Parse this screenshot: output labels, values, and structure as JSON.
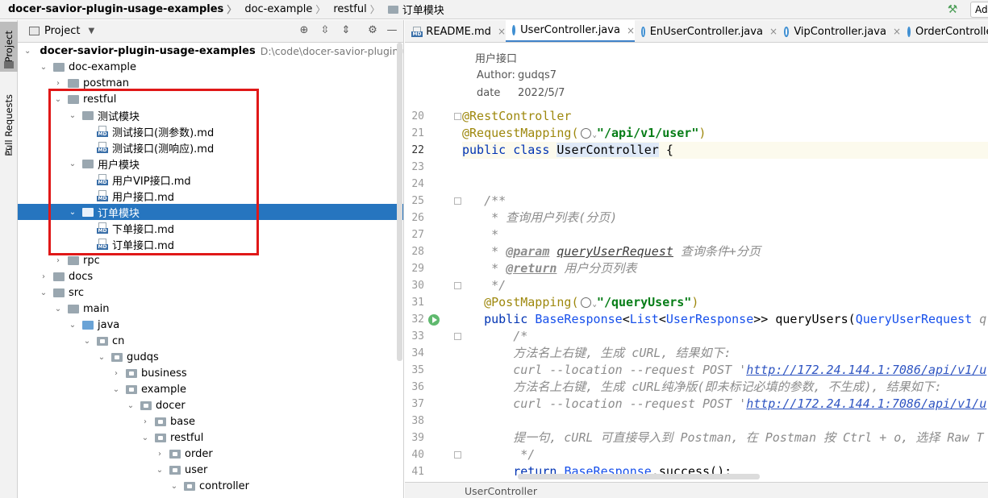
{
  "breadcrumb": [
    {
      "label": "docer-savior-plugin-usage-examples",
      "bold": true
    },
    {
      "label": "doc-example"
    },
    {
      "label": "restful"
    },
    {
      "label": "订单模块",
      "folder": true
    }
  ],
  "toolbar": {
    "add_label": "Ad"
  },
  "left_strip": {
    "project_label": "Project",
    "pull_requests_label": "Pull Requests"
  },
  "project_panel": {
    "title": "Project",
    "root_path": "D:\\code\\docer-savior-plugin-usage"
  },
  "tree": [
    {
      "label": "docer-savior-plugin-usage-examples",
      "depth": 0,
      "state": "open",
      "kind": "module",
      "bold": true
    },
    {
      "label": "doc-example",
      "depth": 1,
      "state": "open",
      "kind": "folder"
    },
    {
      "label": "postman",
      "depth": 2,
      "state": "closed",
      "kind": "folder"
    },
    {
      "label": "restful",
      "depth": 2,
      "state": "open",
      "kind": "folder"
    },
    {
      "label": "测试模块",
      "depth": 3,
      "state": "open",
      "kind": "folder"
    },
    {
      "label": "测试接口(测参数).md",
      "depth": 4,
      "state": "leaf",
      "kind": "md"
    },
    {
      "label": "测试接口(测响应).md",
      "depth": 4,
      "state": "leaf",
      "kind": "md"
    },
    {
      "label": "用户模块",
      "depth": 3,
      "state": "open",
      "kind": "folder"
    },
    {
      "label": "用户VIP接口.md",
      "depth": 4,
      "state": "leaf",
      "kind": "md"
    },
    {
      "label": "用户接口.md",
      "depth": 4,
      "state": "leaf",
      "kind": "md"
    },
    {
      "label": "订单模块",
      "depth": 3,
      "state": "open",
      "kind": "folder",
      "selected": true
    },
    {
      "label": "下单接口.md",
      "depth": 4,
      "state": "leaf",
      "kind": "md"
    },
    {
      "label": "订单接口.md",
      "depth": 4,
      "state": "leaf",
      "kind": "md"
    },
    {
      "label": "rpc",
      "depth": 2,
      "state": "closed",
      "kind": "folder"
    },
    {
      "label": "docs",
      "depth": 1,
      "state": "closed",
      "kind": "folder"
    },
    {
      "label": "src",
      "depth": 1,
      "state": "open",
      "kind": "folder"
    },
    {
      "label": "main",
      "depth": 2,
      "state": "open",
      "kind": "folder"
    },
    {
      "label": "java",
      "depth": 3,
      "state": "open",
      "kind": "src"
    },
    {
      "label": "cn",
      "depth": 4,
      "state": "open",
      "kind": "pkg"
    },
    {
      "label": "gudqs",
      "depth": 5,
      "state": "open",
      "kind": "pkg"
    },
    {
      "label": "business",
      "depth": 6,
      "state": "closed",
      "kind": "pkg"
    },
    {
      "label": "example",
      "depth": 6,
      "state": "open",
      "kind": "pkg"
    },
    {
      "label": "docer",
      "depth": 7,
      "state": "open",
      "kind": "pkg"
    },
    {
      "label": "base",
      "depth": 8,
      "state": "closed",
      "kind": "pkg"
    },
    {
      "label": "restful",
      "depth": 8,
      "state": "open",
      "kind": "pkg"
    },
    {
      "label": "order",
      "depth": 9,
      "state": "closed",
      "kind": "pkg"
    },
    {
      "label": "user",
      "depth": 9,
      "state": "open",
      "kind": "pkg"
    },
    {
      "label": "controller",
      "depth": 10,
      "state": "open",
      "kind": "pkg"
    }
  ],
  "tabs": [
    {
      "label": "README.md",
      "kind": "md",
      "active": false
    },
    {
      "label": "UserController.java",
      "kind": "java",
      "active": true
    },
    {
      "label": "EnUserController.java",
      "kind": "java",
      "active": false
    },
    {
      "label": "VipController.java",
      "kind": "java",
      "active": false
    },
    {
      "label": "OrderControlle",
      "kind": "java",
      "active": false
    }
  ],
  "doc_block": {
    "title": "用户接口",
    "author_label": "Author:",
    "author_value": "gudqs7",
    "date_label": "date",
    "date_value": "2022/5/7"
  },
  "code_lines": [
    {
      "n": "20",
      "text": "@RestController"
    },
    {
      "n": "21",
      "text": "@RequestMapping(\"/api/v1/user\")"
    },
    {
      "n": "22",
      "text": "public class UserController {"
    },
    {
      "n": "23",
      "text": ""
    },
    {
      "n": "24",
      "text": ""
    },
    {
      "n": "25",
      "text": "    /**"
    },
    {
      "n": "26",
      "text": "     * 查询用户列表(分页)"
    },
    {
      "n": "27",
      "text": "     *"
    },
    {
      "n": "28",
      "text": "     * @param queryUserRequest 查询条件+分页"
    },
    {
      "n": "29",
      "text": "     * @return 用户分页列表"
    },
    {
      "n": "30",
      "text": "     */"
    },
    {
      "n": "31",
      "text": "    @PostMapping(\"/queryUsers\")"
    },
    {
      "n": "32",
      "text": "    public BaseResponse<List<UserResponse>> queryUsers(QueryUserRequest q"
    },
    {
      "n": "33",
      "text": "        /*"
    },
    {
      "n": "34",
      "text": "        方法名上右键, 生成 cURL, 结果如下:"
    },
    {
      "n": "35",
      "text": "        curl --location --request POST 'http://172.24.144.1:7086/api/v1/u"
    },
    {
      "n": "36",
      "text": "        方法名上右键, 生成 cURL纯净版(即未标记必填的参数, 不生成), 结果如下:"
    },
    {
      "n": "37",
      "text": "        curl --location --request POST 'http://172.24.144.1:7086/api/v1/u"
    },
    {
      "n": "38",
      "text": ""
    },
    {
      "n": "39",
      "text": "        提一句, cURL 可直接导入到 Postman, 在 Postman 按 Ctrl + o, 选择 Raw T"
    },
    {
      "n": "40",
      "text": "         */"
    },
    {
      "n": "41",
      "text": "        return BaseResponse.success();"
    }
  ],
  "code_tokens": {
    "rest_controller": "@RestController",
    "request_mapping": "@RequestMapping(",
    "request_mapping_path": "\"/api/v1/user\"",
    "close_paren": ")",
    "public": "public",
    "class": "class",
    "class_name": "UserController",
    "open_brace": " {",
    "javadoc_open": "/**",
    "doc_summary": "* 查询用户列表(分页)",
    "doc_star": "*",
    "doc_star_sp": "* ",
    "param_tag": "@param",
    "param_name": "queryUserRequest",
    "param_desc": " 查询条件+分页",
    "return_tag": "@return",
    "return_desc": " 用户分页列表",
    "javadoc_close": "*/",
    "post_mapping": "@PostMapping(",
    "post_mapping_path": "\"/queryUsers\"",
    "base_response": "BaseResponse",
    "lt": "<",
    "list": "List",
    "user_response": "UserResponse",
    "gtgt": ">>",
    "method": " queryUsers(",
    "query_user_request": "QueryUserRequest",
    "trailing_q": " q",
    "block_open": "/*",
    "c34": "方法名上右键, 生成 cURL, 结果如下:",
    "curl_prefix": "curl --location --request POST '",
    "curl_url": "http://172.24.144.1:7086/api/v1/u",
    "c36": "方法名上右键, 生成 cURL纯净版(即未标记必填的参数, 不生成), 结果如下:",
    "c39": "提一句, cURL 可直接导入到 Postman, 在 Postman 按 Ctrl + o, 选择 Raw T",
    "block_close": " */",
    "return": "return",
    "success": ".success();"
  },
  "status_bar": {
    "breadcrumb": "UserController"
  },
  "colors": {
    "accent": "#2675bf",
    "annotation": "#9e880d",
    "keyword": "#0033b3",
    "string": "#067d17",
    "highlight_box": "#e01818"
  }
}
